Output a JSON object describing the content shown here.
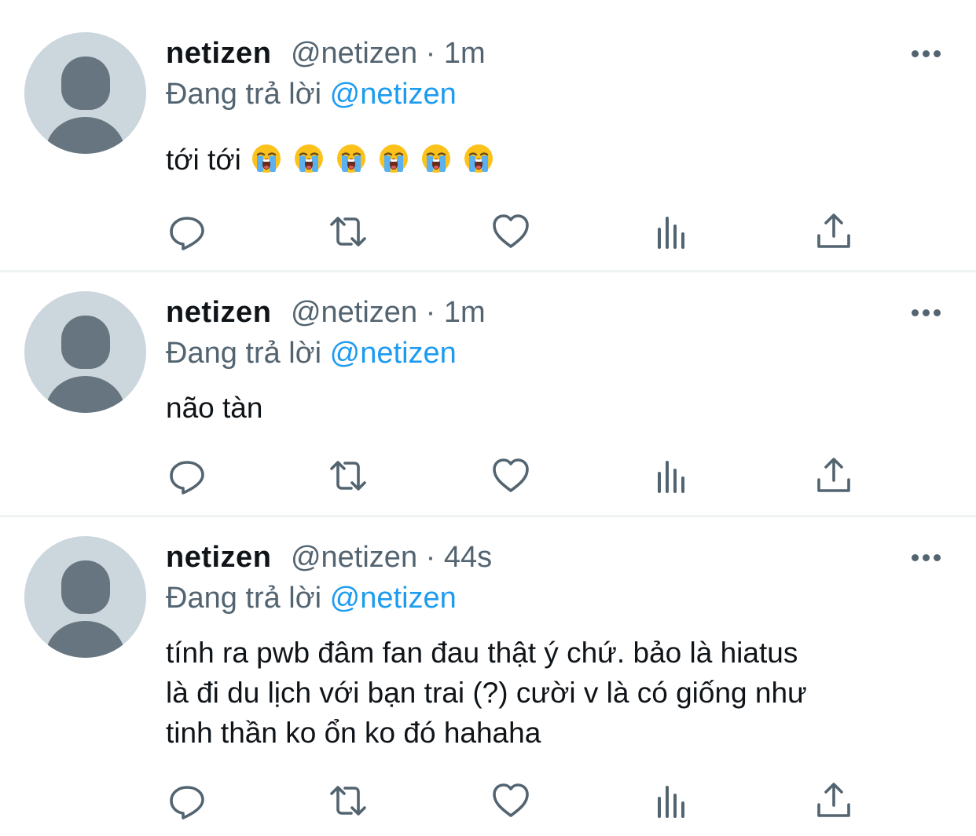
{
  "tweets": [
    {
      "name": "netizen",
      "handle": "@netizen",
      "separator": "·",
      "time": "1m",
      "reply_prefix": "Đang trả lời",
      "reply_to": "@netizen",
      "text": "tới tới",
      "emoji_count": 6,
      "emoji": "loudly-crying-face-icon"
    },
    {
      "name": "netizen",
      "handle": "@netizen",
      "separator": "·",
      "time": "1m",
      "reply_prefix": "Đang trả lời",
      "reply_to": "@netizen",
      "text": "não tàn"
    },
    {
      "name": "netizen",
      "handle": "@netizen",
      "separator": "·",
      "time": "44s",
      "reply_prefix": "Đang trả lời",
      "reply_to": "@netizen",
      "text_lines": [
        "tính ra pwb đâm fan đau thật ý chứ. bảo là hiatus",
        "là đi du lịch với bạn trai (?) cười v là có giống như",
        "tinh thần ko ổn ko đó hahaha"
      ]
    }
  ],
  "icons": {
    "reply": "reply-icon",
    "retweet": "retweet-icon",
    "like": "heart-icon",
    "views": "analytics-icon",
    "share": "share-icon",
    "more": "more-options-icon"
  },
  "colors": {
    "text_primary": "#0f1419",
    "text_secondary": "#536471",
    "accent": "#1d9bf0",
    "avatar_bg": "#ccd6dd",
    "avatar_fg": "#66757f",
    "divider": "#eff3f4"
  }
}
